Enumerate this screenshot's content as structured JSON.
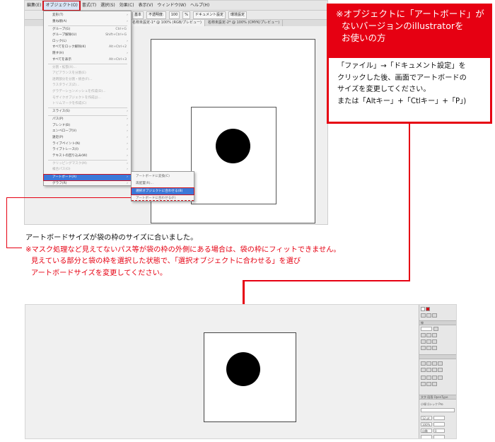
{
  "menubar": {
    "items": [
      "編集(E)",
      "オブジェクト(O)",
      "書式(T)",
      "選択(S)",
      "効果(C)",
      "表示(V)",
      "ウィンドウ(W)",
      "ヘルプ(H)"
    ],
    "highlighted_index": 1
  },
  "toolbar": {
    "items": [
      "基本",
      "不透明度:",
      "100",
      "%",
      "ドキュメント設定",
      "環境設定"
    ]
  },
  "tabs": {
    "items": [
      "名称未設定-1* @ 100% (RGB/プレビュー)",
      "名称未設定-2* @ 100% (CMYK/プレビュー)"
    ]
  },
  "object_menu": {
    "items": [
      {
        "label": "変形(T)",
        "shortcut": "",
        "arrow": true,
        "dim": false
      },
      {
        "label": "重ね順(A)",
        "shortcut": "",
        "arrow": true,
        "dim": false
      },
      {
        "label": "グループ(G)",
        "shortcut": "Ctrl+G",
        "arrow": false,
        "dim": false
      },
      {
        "label": "グループ解除(U)",
        "shortcut": "Shift+Ctrl+G",
        "arrow": false,
        "dim": false
      },
      {
        "label": "ロック(L)",
        "shortcut": "",
        "arrow": true,
        "dim": false
      },
      {
        "label": "すべてをロック解除(K)",
        "shortcut": "Alt+Ctrl+2",
        "arrow": false,
        "dim": false
      },
      {
        "label": "隠す(H)",
        "shortcut": "",
        "arrow": true,
        "dim": false
      },
      {
        "label": "すべてを表示",
        "shortcut": "Alt+Ctrl+3",
        "arrow": false,
        "dim": false
      },
      {
        "label": "分割・拡張(X)...",
        "shortcut": "",
        "arrow": false,
        "dim": true
      },
      {
        "label": "アピアランスを分割(E)",
        "shortcut": "",
        "arrow": false,
        "dim": true
      },
      {
        "label": "透明部分を分割・統合(F)...",
        "shortcut": "",
        "arrow": false,
        "dim": true
      },
      {
        "label": "ラスタライズ(Z)...",
        "shortcut": "",
        "arrow": false,
        "dim": true
      },
      {
        "label": "グラデーションメッシュを作成(D)...",
        "shortcut": "",
        "arrow": false,
        "dim": true
      },
      {
        "label": "モザイクオブジェクトを作成(J)...",
        "shortcut": "",
        "arrow": false,
        "dim": true
      },
      {
        "label": "トリムマークを作成(C)",
        "shortcut": "",
        "arrow": false,
        "dim": true
      },
      {
        "label": "スライス(S)",
        "shortcut": "",
        "arrow": true,
        "dim": false
      },
      {
        "label": "パス(P)",
        "shortcut": "",
        "arrow": true,
        "dim": false
      },
      {
        "label": "ブレンド(B)",
        "shortcut": "",
        "arrow": true,
        "dim": false
      },
      {
        "label": "エンベロープ(V)",
        "shortcut": "",
        "arrow": true,
        "dim": false
      },
      {
        "label": "遠近(P)",
        "shortcut": "",
        "arrow": true,
        "dim": false
      },
      {
        "label": "ライブペイント(N)",
        "shortcut": "",
        "arrow": true,
        "dim": false
      },
      {
        "label": "ライブトレース(I)",
        "shortcut": "",
        "arrow": true,
        "dim": false
      },
      {
        "label": "テキストの回り込み(W)",
        "shortcut": "",
        "arrow": true,
        "dim": false
      },
      {
        "label": "クリッピングマスク(M)",
        "shortcut": "",
        "arrow": true,
        "dim": true
      },
      {
        "label": "複合パス(O)",
        "shortcut": "",
        "arrow": true,
        "dim": true
      },
      {
        "label": "アートボード(A)",
        "shortcut": "",
        "arrow": true,
        "dim": false,
        "selected": true
      },
      {
        "label": "グラフ(R)",
        "shortcut": "",
        "arrow": true,
        "dim": false
      }
    ]
  },
  "artboard_submenu": {
    "items": [
      "アートボードに変換(C)",
      "再配置(R)...",
      "選択オブジェクトに合わせる(B)",
      "アートボードに合わせる(F)"
    ],
    "selected_index": 2
  },
  "note": {
    "heading_lines": [
      "※オブジェクトに「アートボード」が",
      "ないバージョンのillustratorを",
      "お使いの方"
    ],
    "body_lines": [
      "「ファイル」→「ドキュメント設定」を",
      "クリックした後、画面でアートボードの",
      "サイズを変更してください。",
      "または「Altキー」+「Ctlキー」+「P」)"
    ],
    "accent_color": "#e60012"
  },
  "caption": {
    "line1": "アートボードサイズが袋の枠のサイズに合いました。",
    "line2": "※マスク処理など見えてないパス等が袋の枠の外側にある場合は、袋の枠にフィットできません。",
    "line3": "見えている部分と袋の枠を選択した状態で、「選択オブジェクトに合わせる」を選び",
    "line4": "アートボードサイズを変更してください。"
  },
  "right_panel": {
    "tab_labels": [
      "線",
      "文字",
      "段落",
      "OpenType"
    ],
    "font_name": "小塚ゴシック Pro",
    "size_value": "12 pt",
    "scale_value": "100%",
    "tracking_value": "自動",
    "kerning_value": "0"
  }
}
